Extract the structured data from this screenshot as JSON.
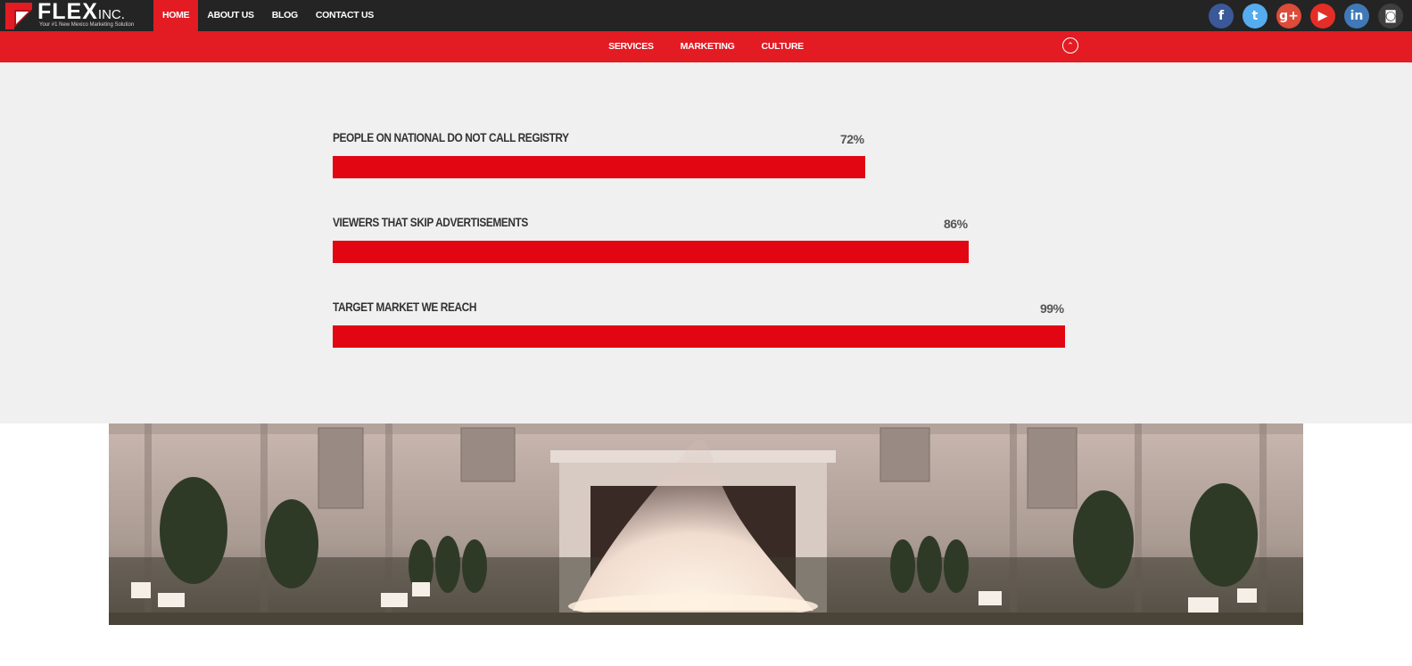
{
  "brand": {
    "name": "FLEX",
    "suffix": "INC.",
    "tagline": "Your #1 New Mexico Marketing Solution"
  },
  "nav": {
    "items": [
      {
        "label": "HOME",
        "active": true
      },
      {
        "label": "ABOUT US",
        "active": false
      },
      {
        "label": "BLOG",
        "active": false
      },
      {
        "label": "CONTACT US",
        "active": false
      }
    ]
  },
  "social": [
    {
      "icon": "facebook-icon",
      "glyph": "f",
      "color": "#3b5998"
    },
    {
      "icon": "twitter-icon",
      "glyph": "t",
      "color": "#55acee"
    },
    {
      "icon": "google-plus-icon",
      "glyph": "g+",
      "color": "#dd4b39"
    },
    {
      "icon": "youtube-icon",
      "glyph": "▶",
      "color": "#e52d27"
    },
    {
      "icon": "linkedin-icon",
      "glyph": "in",
      "color": "#3f79b7"
    },
    {
      "icon": "instagram-icon",
      "glyph": "◙",
      "color": "#3f3f3f"
    }
  ],
  "subnav": {
    "items": [
      {
        "label": "SERVICES",
        "active": false
      },
      {
        "label": "MARKETING",
        "active": true
      },
      {
        "label": "CULTURE",
        "active": false
      }
    ],
    "collapse_icon": "chevron-up-circle-icon",
    "collapse_glyph": "⌃"
  },
  "stats": [
    {
      "label": "PEOPLE ON NATIONAL DO NOT CALL REGISTRY",
      "value": 72,
      "display": "72%"
    },
    {
      "label": "VIEWERS THAT SKIP ADVERTISEMENTS",
      "value": 86,
      "display": "86%"
    },
    {
      "label": "TARGET MARKET WE REACH",
      "value": 99,
      "display": "99%"
    }
  ],
  "colors": {
    "accent": "#e31b23",
    "bar": "#e20612",
    "topbar": "#242424",
    "stats_bg": "#f0f0f0"
  }
}
